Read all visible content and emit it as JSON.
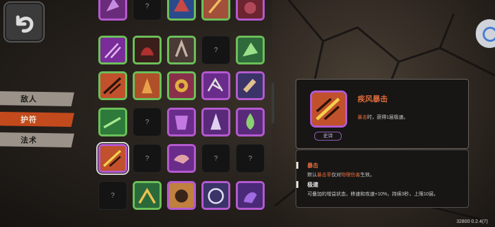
{
  "nav": {
    "back_icon": "back-arrow-icon",
    "tabs": [
      {
        "label": "敌人",
        "active": false
      },
      {
        "label": "护符",
        "active": true
      },
      {
        "label": "法术",
        "active": false
      }
    ]
  },
  "grid": {
    "locked_label": "?"
  },
  "detail": {
    "name": "疾风暴击",
    "desc_keyword": "暴击",
    "desc_rest": "时，获得1层极速。",
    "rarity": "史诗"
  },
  "keywords": [
    {
      "title": "暴击",
      "text_prefix": "默认",
      "hl1": "暴击率",
      "text_mid": "仅对",
      "hl2": "物理伤害",
      "text_suffix": "生效。"
    },
    {
      "title": "极速",
      "text": "可叠加的增益状态，移速和攻速+10%，持续3秒，上限10层。"
    }
  ],
  "version": "32800 0.2.4(7)",
  "colors": {
    "accent": "#c24a1d",
    "keyword": "#e86b3b",
    "rare_green": "#6cc05a",
    "epic_purple": "#b45ad0"
  }
}
